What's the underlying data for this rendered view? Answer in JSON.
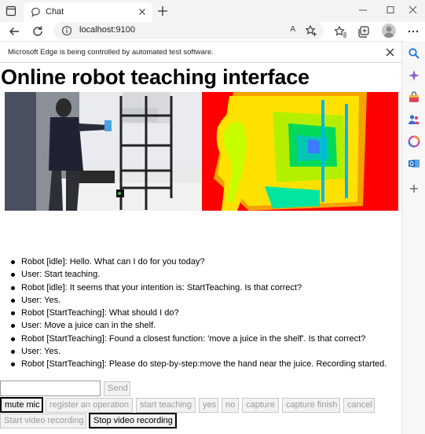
{
  "browser": {
    "tab_title": "Chat",
    "url": "localhost:9100",
    "read_aloud_label": "A",
    "infobar_text": "Microsoft Edge is being controlled by automated test software."
  },
  "page": {
    "title": "Online robot teaching interface"
  },
  "chat": {
    "messages": [
      "Robot [idle]: Hello. What can I do for you today?",
      "User: Start teaching.",
      "Robot [idle]: It seems that your intention is: StartTeaching. Is that correct?",
      "User: Yes.",
      "Robot [StartTeaching]: What should I do?",
      "User: Move a juice can in the shelf.",
      "Robot [StartTeaching]: Found a closest function: 'move a juice in the shelf'. Is that correct?",
      "User: Yes.",
      "Robot [StartTeaching]: Please do step-by-step:move the hand near the juice. Recording started."
    ]
  },
  "controls": {
    "message_input_value": "",
    "send_label": "Send",
    "mute_mic_label": "mute mic",
    "register_operation_label": "register an operation",
    "start_teaching_label": "start teaching",
    "yes_label": "yes",
    "no_label": "no",
    "capture_label": "capture",
    "capture_finish_label": "capture finish",
    "cancel_label": "cancel",
    "start_video_label": "Start video recording",
    "stop_video_label": "Stop video recording"
  },
  "icons": {
    "tab_actions": "tab-actions-icon",
    "favicon": "chat-bubble-icon",
    "back": "back-arrow-icon",
    "refresh": "refresh-icon",
    "info": "info-icon",
    "favorite": "star-plus-icon",
    "favorites": "favorites-icon",
    "collections": "collections-icon",
    "more": "more-icon"
  },
  "colors": {
    "chrome_bg": "#f3f3f3",
    "disabled_text": "#9a9a9a",
    "enabled_border": "#000000"
  }
}
